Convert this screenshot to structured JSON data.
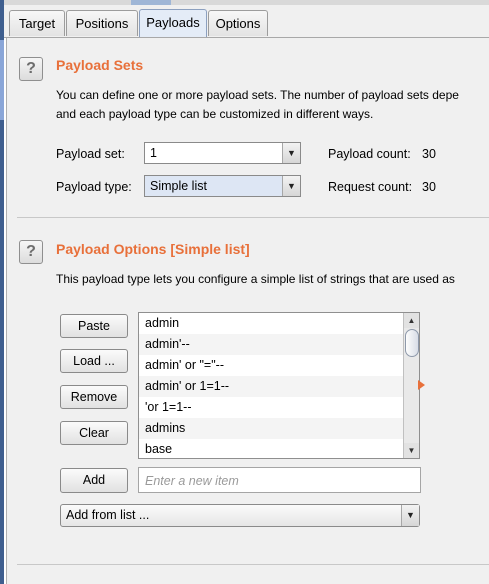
{
  "tabs": [
    {
      "label": "Target"
    },
    {
      "label": "Positions"
    },
    {
      "label": "Payloads"
    },
    {
      "label": "Options"
    }
  ],
  "payload_sets": {
    "title": "Payload Sets",
    "description_line1": "You can define one or more payload sets. The number of payload sets depe",
    "description_line2": "and each payload type can be customized in different ways.",
    "payload_set_label": "Payload set:",
    "payload_set_value": "1",
    "payload_type_label": "Payload type:",
    "payload_type_value": "Simple list",
    "payload_count_label": "Payload count:",
    "payload_count_value": "30",
    "request_count_label": "Request count:",
    "request_count_value": "30"
  },
  "payload_options": {
    "title": "Payload Options [Simple list]",
    "description": "This payload type lets you configure a simple list of strings that are used as",
    "buttons": {
      "paste": "Paste",
      "load": "Load ...",
      "remove": "Remove",
      "clear": "Clear",
      "add": "Add"
    },
    "list_items": [
      "admin",
      "admin'--",
      "admin' or \"=\"--",
      "admin' or 1=1--",
      "'or 1=1--",
      "admins",
      "base"
    ],
    "new_item_placeholder": "Enter a new item",
    "add_from_list": "Add from list ..."
  },
  "icons": {
    "help": "help-icon",
    "dropdown": "chevron-down-icon",
    "scroll_up": "scroll-up-icon",
    "scroll_down": "scroll-down-icon",
    "expand": "orange-arrow-icon"
  },
  "colors": {
    "section_title": "#e8703a",
    "panel_background": "#f0f0f0",
    "active_tab": "#e4ecf7"
  }
}
